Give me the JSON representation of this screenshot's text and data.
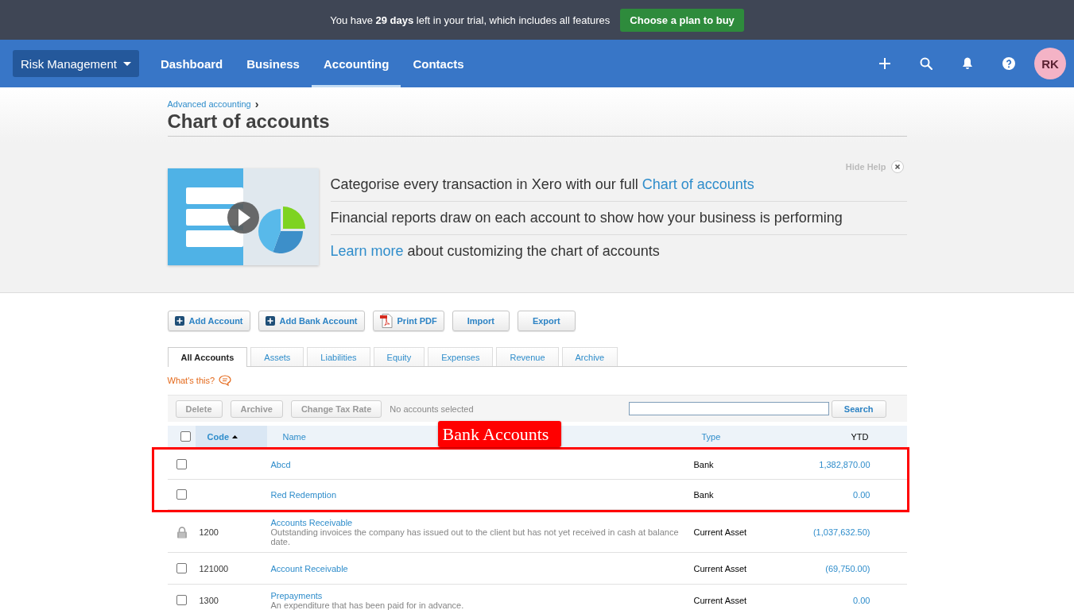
{
  "trial_bar": {
    "message": "You have **29 days** left in your trial, which includes all features",
    "button": "Choose a plan to buy"
  },
  "nav": {
    "organisation": "Risk Management",
    "items": [
      {
        "label": "Dashboard",
        "selected": false
      },
      {
        "label": "Business",
        "selected": false
      },
      {
        "label": "Accounting",
        "selected": true
      },
      {
        "label": "Contacts",
        "selected": false
      }
    ],
    "avatar": "RK"
  },
  "breadcrumb": {
    "link": "Advanced accounting",
    "separator": "›"
  },
  "title": "Chart of accounts",
  "help": {
    "hide_label": "Hide Help",
    "lines": [
      {
        "parts": [
          {
            "kind": "text",
            "text": "Categorise every transaction in Xero with our full"
          },
          {
            "kind": "link",
            "text": "Chart of accounts"
          }
        ]
      },
      {
        "parts": [
          {
            "kind": "text",
            "text": "Financial reports draw on each account to show how your business is performing"
          }
        ]
      },
      {
        "parts": [
          {
            "kind": "link",
            "text": "Learn more"
          },
          {
            "kind": "text",
            "text": "about customizing the chart of accounts"
          }
        ]
      }
    ]
  },
  "actions": [
    {
      "label": "Add Account",
      "kind": "add"
    },
    {
      "label": "Add Bank Account",
      "kind": "add"
    },
    {
      "label": "Print PDF",
      "kind": "pdf"
    },
    {
      "label": "Import",
      "kind": "plain"
    },
    {
      "label": "Export",
      "kind": "plain"
    }
  ],
  "tabs": [
    {
      "label": "All Accounts",
      "selected": true
    },
    {
      "label": "Assets",
      "selected": false
    },
    {
      "label": "Liabilities",
      "selected": false
    },
    {
      "label": "Equity",
      "selected": false
    },
    {
      "label": "Expenses",
      "selected": false
    },
    {
      "label": "Revenue",
      "selected": false
    },
    {
      "label": "Archive",
      "selected": false
    }
  ],
  "whats_this": "What's this?",
  "toolbar": {
    "buttons": [
      {
        "label": "Delete",
        "disabled": true
      },
      {
        "label": "Archive",
        "disabled": true
      },
      {
        "label": "Change Tax Rate",
        "disabled": true
      }
    ],
    "status": "No accounts selected",
    "search_button": "Search"
  },
  "table": {
    "select_all": {
      "checked": false
    },
    "columns": [
      {
        "label": "Code",
        "sortable": true,
        "sorted": true
      },
      {
        "label": "Name",
        "sortable": true,
        "sorted": false
      },
      {
        "label": "Type",
        "sortable": true,
        "sorted": false
      },
      {
        "label": "YTD",
        "sortable": false,
        "sorted": false
      }
    ],
    "rows": [
      {
        "kind": "checkbox",
        "checked": false,
        "callout": true,
        "name": "Abcd",
        "type": "Bank",
        "ytd": "1,382,870.00"
      },
      {
        "kind": "checkbox",
        "checked": false,
        "callout": true,
        "name": "Red Redemption",
        "type": "Bank",
        "ytd": "0.00"
      },
      {
        "kind": "locked",
        "callout": false,
        "code": "1200",
        "name": "Accounts Receivable",
        "description": "Outstanding invoices the company has issued out to the client but has not yet received in cash at balance date.",
        "type": "Current Asset",
        "ytd": "(1,037,632.50)"
      },
      {
        "kind": "checkbox",
        "checked": false,
        "callout": false,
        "code": "121000",
        "name": "Account Receivable",
        "type": "Current Asset",
        "ytd": "(69,750.00)"
      },
      {
        "kind": "checkbox",
        "checked": false,
        "callout": false,
        "code": "1300",
        "name": "Prepayments",
        "description": "An expenditure that has been paid for in advance.",
        "type": "Current Asset",
        "ytd": "0.00"
      }
    ]
  },
  "annotation": {
    "label": "Bank Accounts"
  }
}
